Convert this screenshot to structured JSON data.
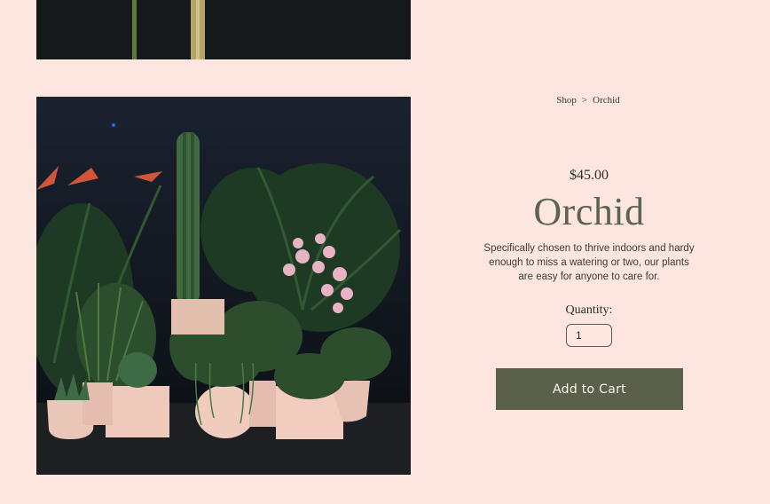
{
  "breadcrumb": {
    "shop": "Shop",
    "separator": ">",
    "current": "Orchid"
  },
  "product": {
    "price": "$45.00",
    "title": "Orchid",
    "description": "Specifically chosen to thrive indoors and hardy enough to miss a watering or two, our plants are easy for anyone to care for.",
    "quantity_label": "Quantity:",
    "quantity_value": "1",
    "add_to_cart_label": "Add to Cart"
  },
  "colors": {
    "page_background": "#fde6df",
    "button_background": "#5a604a",
    "title_color": "#5e6250",
    "photo_background": "#111820"
  }
}
